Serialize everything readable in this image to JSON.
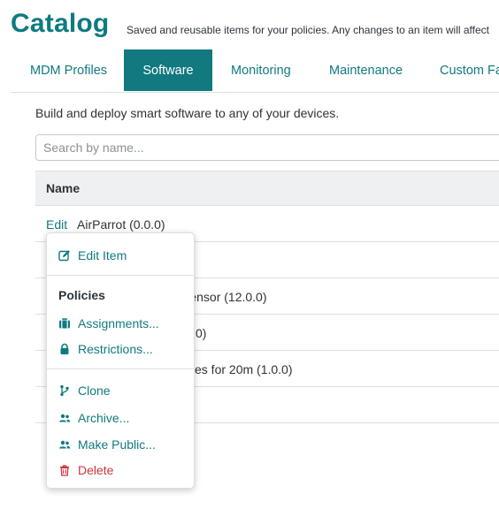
{
  "header": {
    "title": "Catalog",
    "subtitle": "Saved and reusable items for your policies. Any changes to an item will affect"
  },
  "tabs": [
    {
      "label": "MDM Profiles",
      "active": false
    },
    {
      "label": "Software",
      "active": true
    },
    {
      "label": "Monitoring",
      "active": false
    },
    {
      "label": "Maintenance",
      "active": false
    },
    {
      "label": "Custom Fa",
      "active": false
    }
  ],
  "intro": "Build and deploy smart software to any of your devices.",
  "search": {
    "placeholder": "Search by name...",
    "value": ""
  },
  "table": {
    "header": "Name",
    "rows": [
      {
        "edit": "Edit",
        "name": "AirParrot (0.0.0)"
      },
      {
        "edit": "",
        "name": ""
      },
      {
        "edit": "",
        "name": "Sensor (12.0.0)"
      },
      {
        "edit": "",
        "name": "0)"
      },
      {
        "edit": "",
        "name": "es for 20m (1.0.0)"
      },
      {
        "edit": "",
        "name": ""
      }
    ]
  },
  "menu": {
    "edit_item": "Edit Item",
    "policies_heading": "Policies",
    "assignments": "Assignments...",
    "restrictions": "Restrictions...",
    "clone": "Clone",
    "archive": "Archive...",
    "make_public": "Make Public...",
    "delete": "Delete"
  },
  "colors": {
    "accent": "#0f7a80",
    "danger": "#d0343c",
    "text": "#2d3338",
    "header_bg": "#eef0f2"
  },
  "icons": [
    "edit-icon",
    "briefcase-icon",
    "lock-icon",
    "branch-icon",
    "users-icon",
    "trash-icon"
  ]
}
